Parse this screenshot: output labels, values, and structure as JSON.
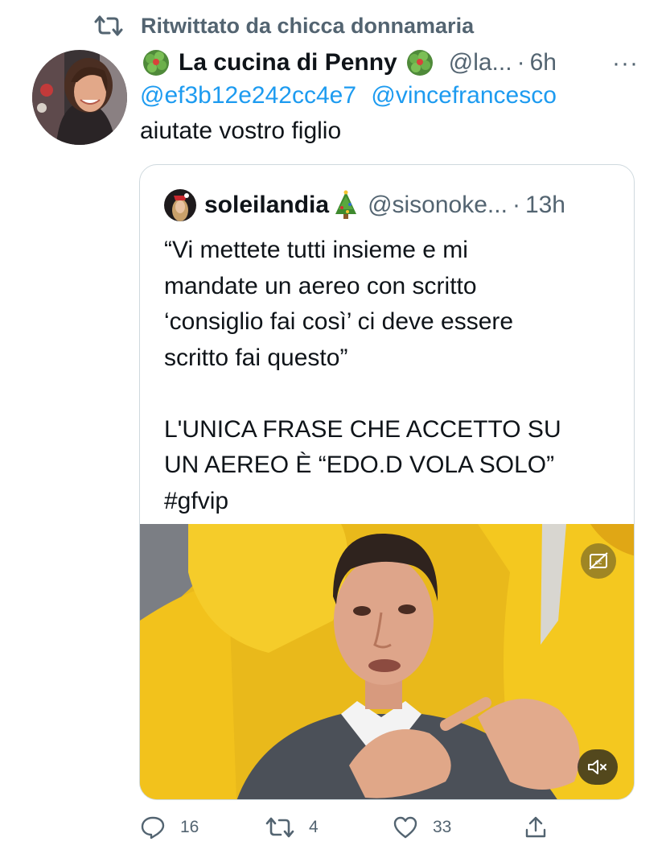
{
  "retweet": {
    "label": "Ritwittato da chicca donnamaria",
    "icon": "retweet-icon"
  },
  "tweet": {
    "display_name": "La cucina di Penny",
    "name_emoji": "broccoli-icon",
    "handle": "@la...",
    "separator": "·",
    "time": "6h",
    "more": "···",
    "mentions": [
      "@ef3b12e242cc4e7",
      "@vincefrancesco"
    ],
    "text": "aiutate vostro figlio"
  },
  "quote": {
    "display_name": "soleilandia",
    "name_emoji": "christmas-tree-icon",
    "handle": "@sisonoke...",
    "separator": "·",
    "time": "13h",
    "text": "“Vi mettete tutti insieme e mi\nmandate un aereo con scritto\n‘consiglio fai così’ ci deve essere\nscritto fai questo”\n\nL'UNICA FRASE CHE ACCETTO SU\nUN AEREO È “EDO.D VOLA SOLO”\n#gfvip",
    "media": {
      "type": "video",
      "cc_icon": "captions-off-icon",
      "mute_icon": "volume-muted-icon"
    }
  },
  "actions": {
    "replies": "16",
    "retweets": "4",
    "likes": "33",
    "share_icon": "share-icon"
  },
  "colors": {
    "link": "#1d9bf0",
    "secondary": "#536471",
    "text": "#0f1419",
    "border": "#cfd9de"
  }
}
